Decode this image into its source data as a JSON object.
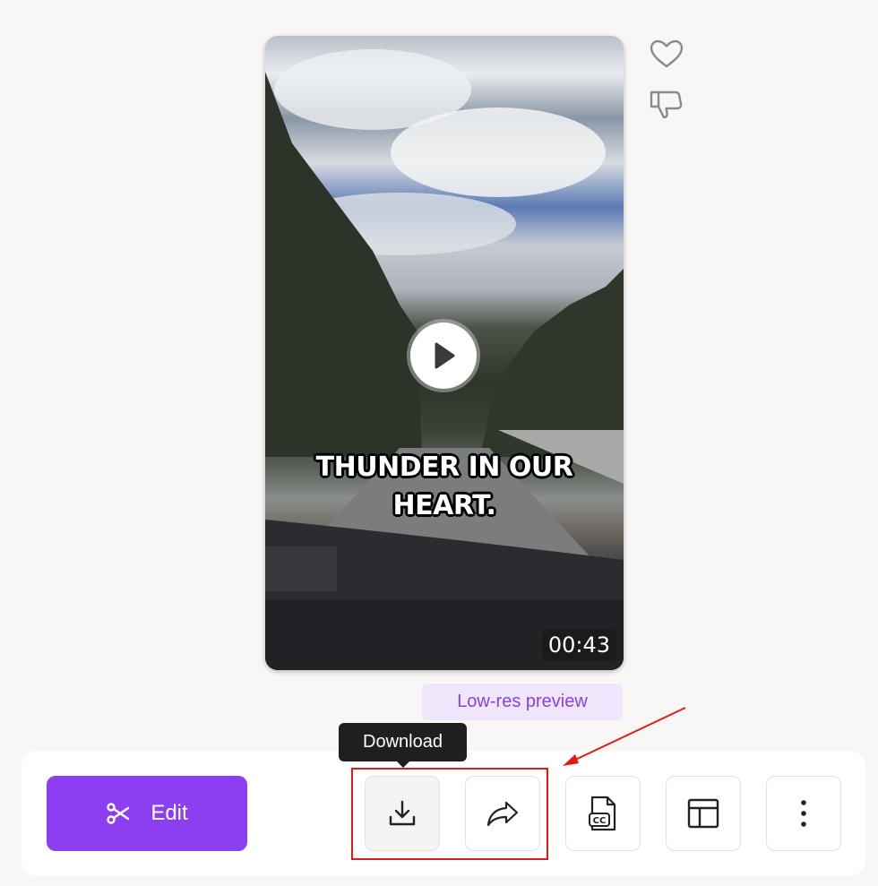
{
  "video": {
    "caption": "THUNDER IN OUR HEART.",
    "duration": "00:43"
  },
  "side_actions": {
    "like_icon": "heart-icon",
    "dislike_icon": "thumbs-down-icon"
  },
  "preview_badge": "Low-res preview",
  "tooltip": "Download",
  "toolbar": {
    "edit_label": "Edit",
    "buttons": [
      {
        "icon": "download-icon"
      },
      {
        "icon": "share-icon"
      },
      {
        "icon": "captions-file-icon"
      },
      {
        "icon": "layout-icon"
      },
      {
        "icon": "more-vertical-icon"
      }
    ]
  },
  "colors": {
    "accent": "#8b3ff0",
    "badge_bg": "#efe6fb",
    "badge_text": "#8b3fe0",
    "annotation": "#e01919"
  }
}
